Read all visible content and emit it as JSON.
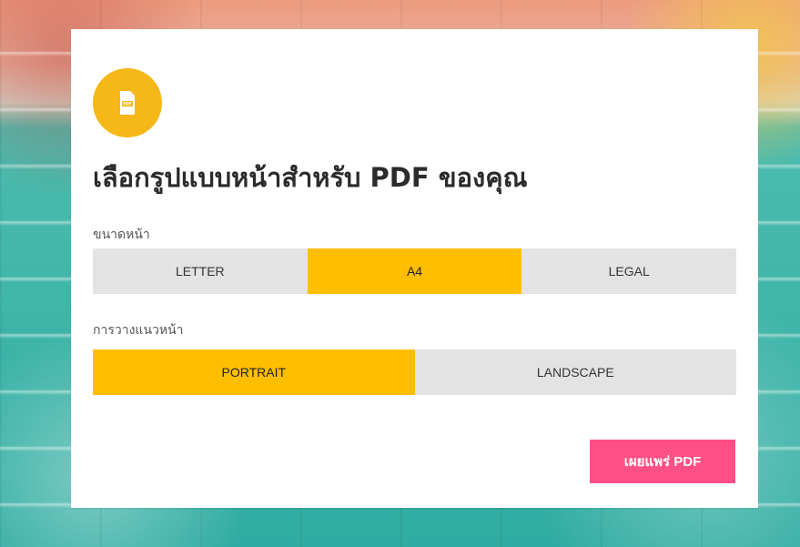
{
  "colors": {
    "accent": "#ffbe00",
    "icon_circle": "#f6b719",
    "publish_button": "#ff4f87",
    "segment_inactive": "#e3e3e3",
    "card_background": "#ffffff"
  },
  "dialog": {
    "icon_name": "pdf-icon",
    "title": "เลือกรูปแบบหน้าสำหรับ PDF ของคุณ"
  },
  "page_size": {
    "label": "ขนาดหน้า",
    "options": [
      {
        "label": "LETTER",
        "selected": false
      },
      {
        "label": "A4",
        "selected": true
      },
      {
        "label": "LEGAL",
        "selected": false
      }
    ]
  },
  "orientation": {
    "label": "การวางแนวหน้า",
    "options": [
      {
        "label": "PORTRAIT",
        "selected": true
      },
      {
        "label": "LANDSCAPE",
        "selected": false
      }
    ]
  },
  "actions": {
    "publish_label": "เผยแพร่ PDF"
  }
}
